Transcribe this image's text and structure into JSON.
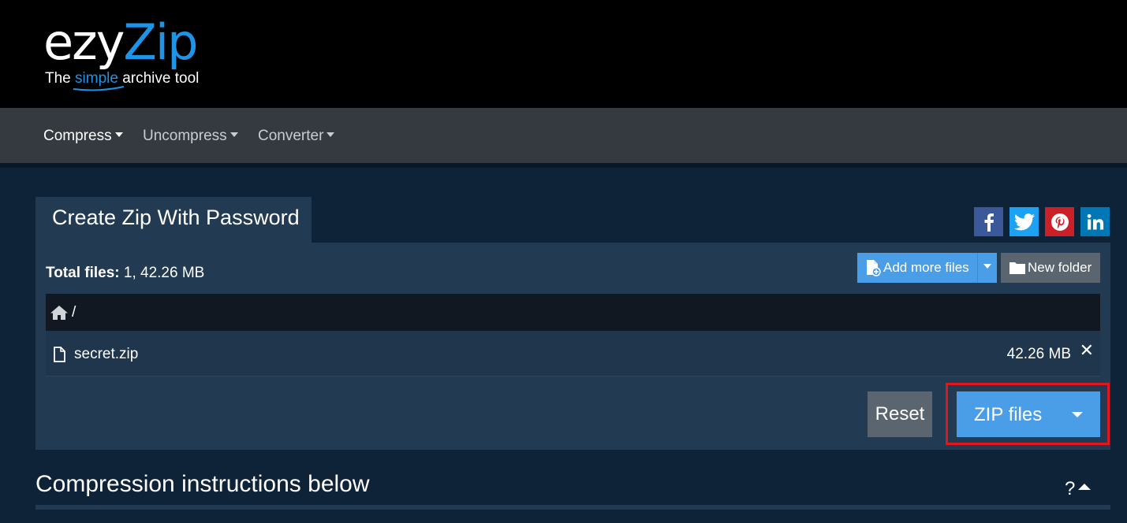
{
  "brand": {
    "name_part1": "ezy",
    "name_part2": "Zip",
    "tagline_pre": "The ",
    "tagline_highlight": "simple",
    "tagline_post": " archive tool",
    "accent_color": "#1e94e6"
  },
  "nav": {
    "items": [
      {
        "label": "Compress",
        "active": true
      },
      {
        "label": "Uncompress",
        "active": false
      },
      {
        "label": "Converter",
        "active": false
      }
    ]
  },
  "tool": {
    "tab_title": "Create Zip With Password"
  },
  "social": {
    "icons": [
      "facebook-icon",
      "twitter-icon",
      "pinterest-icon",
      "linkedin-icon"
    ]
  },
  "files_panel": {
    "total_label": "Total files:",
    "total_value": " 1, 42.26 MB",
    "add_more_label": "Add more files",
    "new_folder_label": "New folder",
    "path": "/",
    "files": [
      {
        "name": "secret.zip",
        "size": "42.26 MB"
      }
    ],
    "remove_symbol": "✕"
  },
  "actions": {
    "reset_label": "Reset",
    "zip_label": "ZIP files",
    "highlight_color": "#e3161e"
  },
  "instructions": {
    "title": "Compression instructions below",
    "help_symbol": "?"
  }
}
